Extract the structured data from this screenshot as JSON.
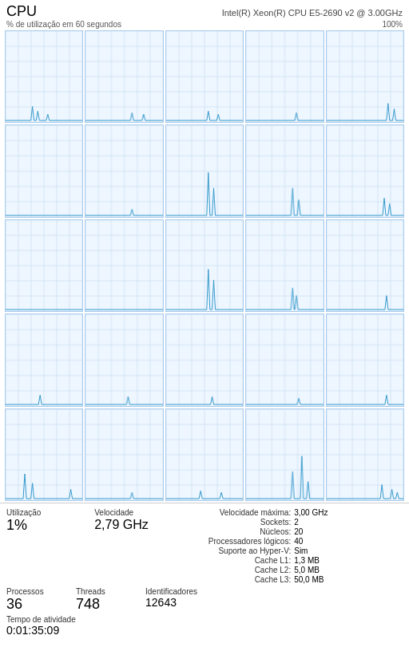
{
  "header": {
    "title": "CPU",
    "cpu_name": "Intel(R) Xeon(R) CPU E5-2690 v2 @ 3.00GHz",
    "y_label": "% de utilização em 60 segundos",
    "y_max": "100%"
  },
  "stats": {
    "utilizacao_label": "Utilização",
    "utilizacao_value": "1%",
    "velocidade_label": "Velocidade",
    "velocidade_value": "2,79 GHz",
    "processos_label": "Processos",
    "processos_value": "36",
    "threads_label": "Threads",
    "threads_value": "748",
    "identificadores_label": "Identificadores",
    "identificadores_value": "12643",
    "tempo_label": "Tempo de atividade",
    "tempo_value": "0:01:35:09"
  },
  "right_stats": {
    "velocidade_maxima_label": "Velocidade máxima:",
    "velocidade_maxima_value": "3,00 GHz",
    "sockets_label": "Sockets:",
    "sockets_value": "2",
    "nucleos_label": "Núcleos:",
    "nucleos_value": "20",
    "proc_logicos_label": "Processadores lógicos:",
    "proc_logicos_value": "40",
    "hyper_v_label": "Suporte ao Hyper-V:",
    "hyper_v_value": "Sim",
    "cache_l1_label": "Cache L1:",
    "cache_l1_value": "1,3 MB",
    "cache_l2_label": "Cache L2:",
    "cache_l2_value": "5,0 MB",
    "cache_l3_label": "Cache L3:",
    "cache_l3_value": "50,0 MB"
  },
  "graphs": {
    "count": 25,
    "grid_color": "#c8dff0",
    "line_color": "#3399cc",
    "bg_color": "#eef6ff"
  }
}
